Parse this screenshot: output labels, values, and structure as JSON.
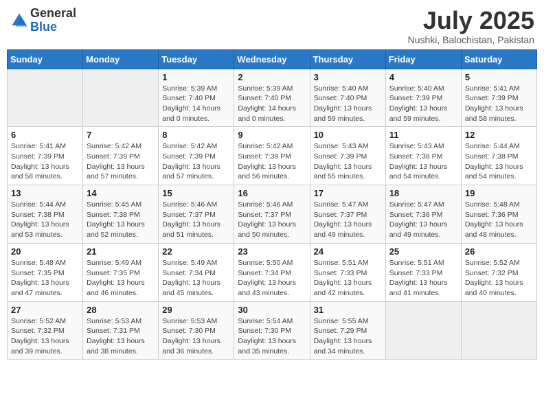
{
  "logo": {
    "general": "General",
    "blue": "Blue"
  },
  "header": {
    "month": "July 2025",
    "location": "Nushki, Balochistan, Pakistan"
  },
  "weekdays": [
    "Sunday",
    "Monday",
    "Tuesday",
    "Wednesday",
    "Thursday",
    "Friday",
    "Saturday"
  ],
  "weeks": [
    [
      {
        "day": "",
        "sunrise": "",
        "sunset": "",
        "daylight": ""
      },
      {
        "day": "",
        "sunrise": "",
        "sunset": "",
        "daylight": ""
      },
      {
        "day": "1",
        "sunrise": "Sunrise: 5:39 AM",
        "sunset": "Sunset: 7:40 PM",
        "daylight": "Daylight: 14 hours and 0 minutes."
      },
      {
        "day": "2",
        "sunrise": "Sunrise: 5:39 AM",
        "sunset": "Sunset: 7:40 PM",
        "daylight": "Daylight: 14 hours and 0 minutes."
      },
      {
        "day": "3",
        "sunrise": "Sunrise: 5:40 AM",
        "sunset": "Sunset: 7:40 PM",
        "daylight": "Daylight: 13 hours and 59 minutes."
      },
      {
        "day": "4",
        "sunrise": "Sunrise: 5:40 AM",
        "sunset": "Sunset: 7:39 PM",
        "daylight": "Daylight: 13 hours and 59 minutes."
      },
      {
        "day": "5",
        "sunrise": "Sunrise: 5:41 AM",
        "sunset": "Sunset: 7:39 PM",
        "daylight": "Daylight: 13 hours and 58 minutes."
      }
    ],
    [
      {
        "day": "6",
        "sunrise": "Sunrise: 5:41 AM",
        "sunset": "Sunset: 7:39 PM",
        "daylight": "Daylight: 13 hours and 58 minutes."
      },
      {
        "day": "7",
        "sunrise": "Sunrise: 5:42 AM",
        "sunset": "Sunset: 7:39 PM",
        "daylight": "Daylight: 13 hours and 57 minutes."
      },
      {
        "day": "8",
        "sunrise": "Sunrise: 5:42 AM",
        "sunset": "Sunset: 7:39 PM",
        "daylight": "Daylight: 13 hours and 57 minutes."
      },
      {
        "day": "9",
        "sunrise": "Sunrise: 5:42 AM",
        "sunset": "Sunset: 7:39 PM",
        "daylight": "Daylight: 13 hours and 56 minutes."
      },
      {
        "day": "10",
        "sunrise": "Sunrise: 5:43 AM",
        "sunset": "Sunset: 7:39 PM",
        "daylight": "Daylight: 13 hours and 55 minutes."
      },
      {
        "day": "11",
        "sunrise": "Sunrise: 5:43 AM",
        "sunset": "Sunset: 7:38 PM",
        "daylight": "Daylight: 13 hours and 54 minutes."
      },
      {
        "day": "12",
        "sunrise": "Sunrise: 5:44 AM",
        "sunset": "Sunset: 7:38 PM",
        "daylight": "Daylight: 13 hours and 54 minutes."
      }
    ],
    [
      {
        "day": "13",
        "sunrise": "Sunrise: 5:44 AM",
        "sunset": "Sunset: 7:38 PM",
        "daylight": "Daylight: 13 hours and 53 minutes."
      },
      {
        "day": "14",
        "sunrise": "Sunrise: 5:45 AM",
        "sunset": "Sunset: 7:38 PM",
        "daylight": "Daylight: 13 hours and 52 minutes."
      },
      {
        "day": "15",
        "sunrise": "Sunrise: 5:46 AM",
        "sunset": "Sunset: 7:37 PM",
        "daylight": "Daylight: 13 hours and 51 minutes."
      },
      {
        "day": "16",
        "sunrise": "Sunrise: 5:46 AM",
        "sunset": "Sunset: 7:37 PM",
        "daylight": "Daylight: 13 hours and 50 minutes."
      },
      {
        "day": "17",
        "sunrise": "Sunrise: 5:47 AM",
        "sunset": "Sunset: 7:37 PM",
        "daylight": "Daylight: 13 hours and 49 minutes."
      },
      {
        "day": "18",
        "sunrise": "Sunrise: 5:47 AM",
        "sunset": "Sunset: 7:36 PM",
        "daylight": "Daylight: 13 hours and 49 minutes."
      },
      {
        "day": "19",
        "sunrise": "Sunrise: 5:48 AM",
        "sunset": "Sunset: 7:36 PM",
        "daylight": "Daylight: 13 hours and 48 minutes."
      }
    ],
    [
      {
        "day": "20",
        "sunrise": "Sunrise: 5:48 AM",
        "sunset": "Sunset: 7:35 PM",
        "daylight": "Daylight: 13 hours and 47 minutes."
      },
      {
        "day": "21",
        "sunrise": "Sunrise: 5:49 AM",
        "sunset": "Sunset: 7:35 PM",
        "daylight": "Daylight: 13 hours and 46 minutes."
      },
      {
        "day": "22",
        "sunrise": "Sunrise: 5:49 AM",
        "sunset": "Sunset: 7:34 PM",
        "daylight": "Daylight: 13 hours and 45 minutes."
      },
      {
        "day": "23",
        "sunrise": "Sunrise: 5:50 AM",
        "sunset": "Sunset: 7:34 PM",
        "daylight": "Daylight: 13 hours and 43 minutes."
      },
      {
        "day": "24",
        "sunrise": "Sunrise: 5:51 AM",
        "sunset": "Sunset: 7:33 PM",
        "daylight": "Daylight: 13 hours and 42 minutes."
      },
      {
        "day": "25",
        "sunrise": "Sunrise: 5:51 AM",
        "sunset": "Sunset: 7:33 PM",
        "daylight": "Daylight: 13 hours and 41 minutes."
      },
      {
        "day": "26",
        "sunrise": "Sunrise: 5:52 AM",
        "sunset": "Sunset: 7:32 PM",
        "daylight": "Daylight: 13 hours and 40 minutes."
      }
    ],
    [
      {
        "day": "27",
        "sunrise": "Sunrise: 5:52 AM",
        "sunset": "Sunset: 7:32 PM",
        "daylight": "Daylight: 13 hours and 39 minutes."
      },
      {
        "day": "28",
        "sunrise": "Sunrise: 5:53 AM",
        "sunset": "Sunset: 7:31 PM",
        "daylight": "Daylight: 13 hours and 38 minutes."
      },
      {
        "day": "29",
        "sunrise": "Sunrise: 5:53 AM",
        "sunset": "Sunset: 7:30 PM",
        "daylight": "Daylight: 13 hours and 36 minutes."
      },
      {
        "day": "30",
        "sunrise": "Sunrise: 5:54 AM",
        "sunset": "Sunset: 7:30 PM",
        "daylight": "Daylight: 13 hours and 35 minutes."
      },
      {
        "day": "31",
        "sunrise": "Sunrise: 5:55 AM",
        "sunset": "Sunset: 7:29 PM",
        "daylight": "Daylight: 13 hours and 34 minutes."
      },
      {
        "day": "",
        "sunrise": "",
        "sunset": "",
        "daylight": ""
      },
      {
        "day": "",
        "sunrise": "",
        "sunset": "",
        "daylight": ""
      }
    ]
  ]
}
